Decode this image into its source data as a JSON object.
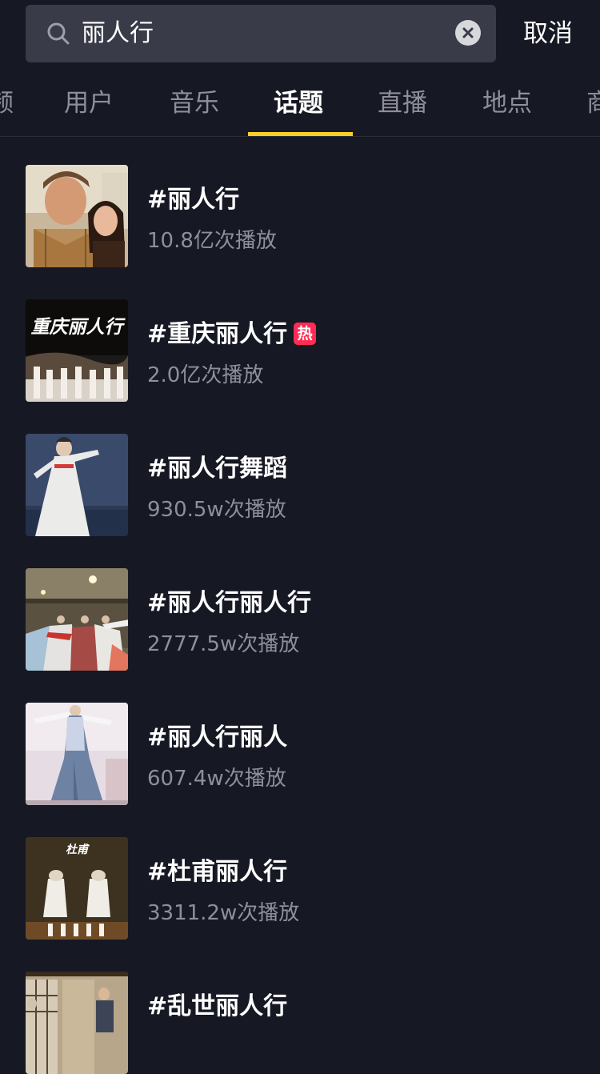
{
  "search": {
    "query": "丽人行",
    "cancel_label": "取消"
  },
  "tabs": [
    {
      "label": "频"
    },
    {
      "label": "用户"
    },
    {
      "label": "音乐"
    },
    {
      "label": "话题",
      "active": true
    },
    {
      "label": "直播"
    },
    {
      "label": "地点"
    },
    {
      "label": "商"
    }
  ],
  "results": [
    {
      "title": "#丽人行",
      "count": "10.8亿次播放"
    },
    {
      "title": "#重庆丽人行",
      "count": "2.0亿次播放",
      "badge": "热"
    },
    {
      "title": "#丽人行舞蹈",
      "count": "930.5w次播放"
    },
    {
      "title": "#丽人行丽人行",
      "count": "2777.5w次播放"
    },
    {
      "title": "#丽人行丽人",
      "count": "607.4w次播放"
    },
    {
      "title": "#杜甫丽人行",
      "count": "3311.2w次播放"
    },
    {
      "title": "#乱世丽人行",
      "count": ""
    }
  ],
  "thumb_texts": {
    "chongqing": "重庆丽人行",
    "dufu": "杜甫"
  },
  "colors": {
    "background": "#161823",
    "accent": "#facd2d",
    "hot": "#fe2c55",
    "secondary_text": "#8e8f99"
  }
}
